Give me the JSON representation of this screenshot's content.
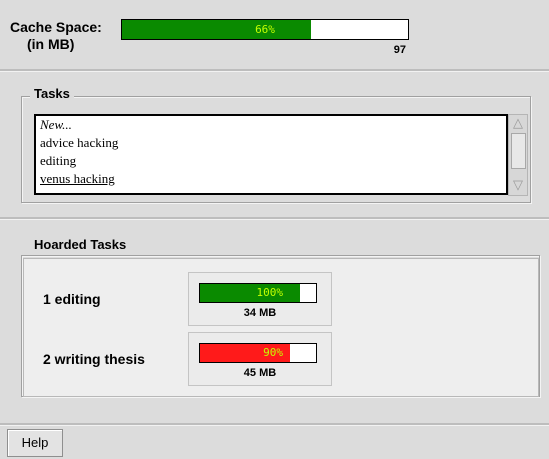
{
  "cache": {
    "label": "Cache Space:",
    "sublabel": "(in MB)",
    "fill_fraction": 0.66,
    "percent_text": "66%",
    "value": "97",
    "fill_color": "#0a8a00"
  },
  "tasks": {
    "title": "Tasks",
    "items": [
      "New...",
      "advice hacking",
      "editing",
      "venus hacking"
    ]
  },
  "hoarded": {
    "title": "Hoarded Tasks",
    "items": [
      {
        "label": "1 editing",
        "percent_text": "100%",
        "fraction": 1.0,
        "size": "34 MB",
        "fill_color": "#0a8a00"
      },
      {
        "label": "2 writing thesis",
        "percent_text": "90%",
        "fraction": 0.9,
        "size": "45 MB",
        "fill_color": "#ff1a1a"
      }
    ]
  },
  "help_label": "Help",
  "icons": {
    "scroll_up": "scroll-up-arrow-icon",
    "scroll_down": "scroll-down-arrow-icon"
  }
}
